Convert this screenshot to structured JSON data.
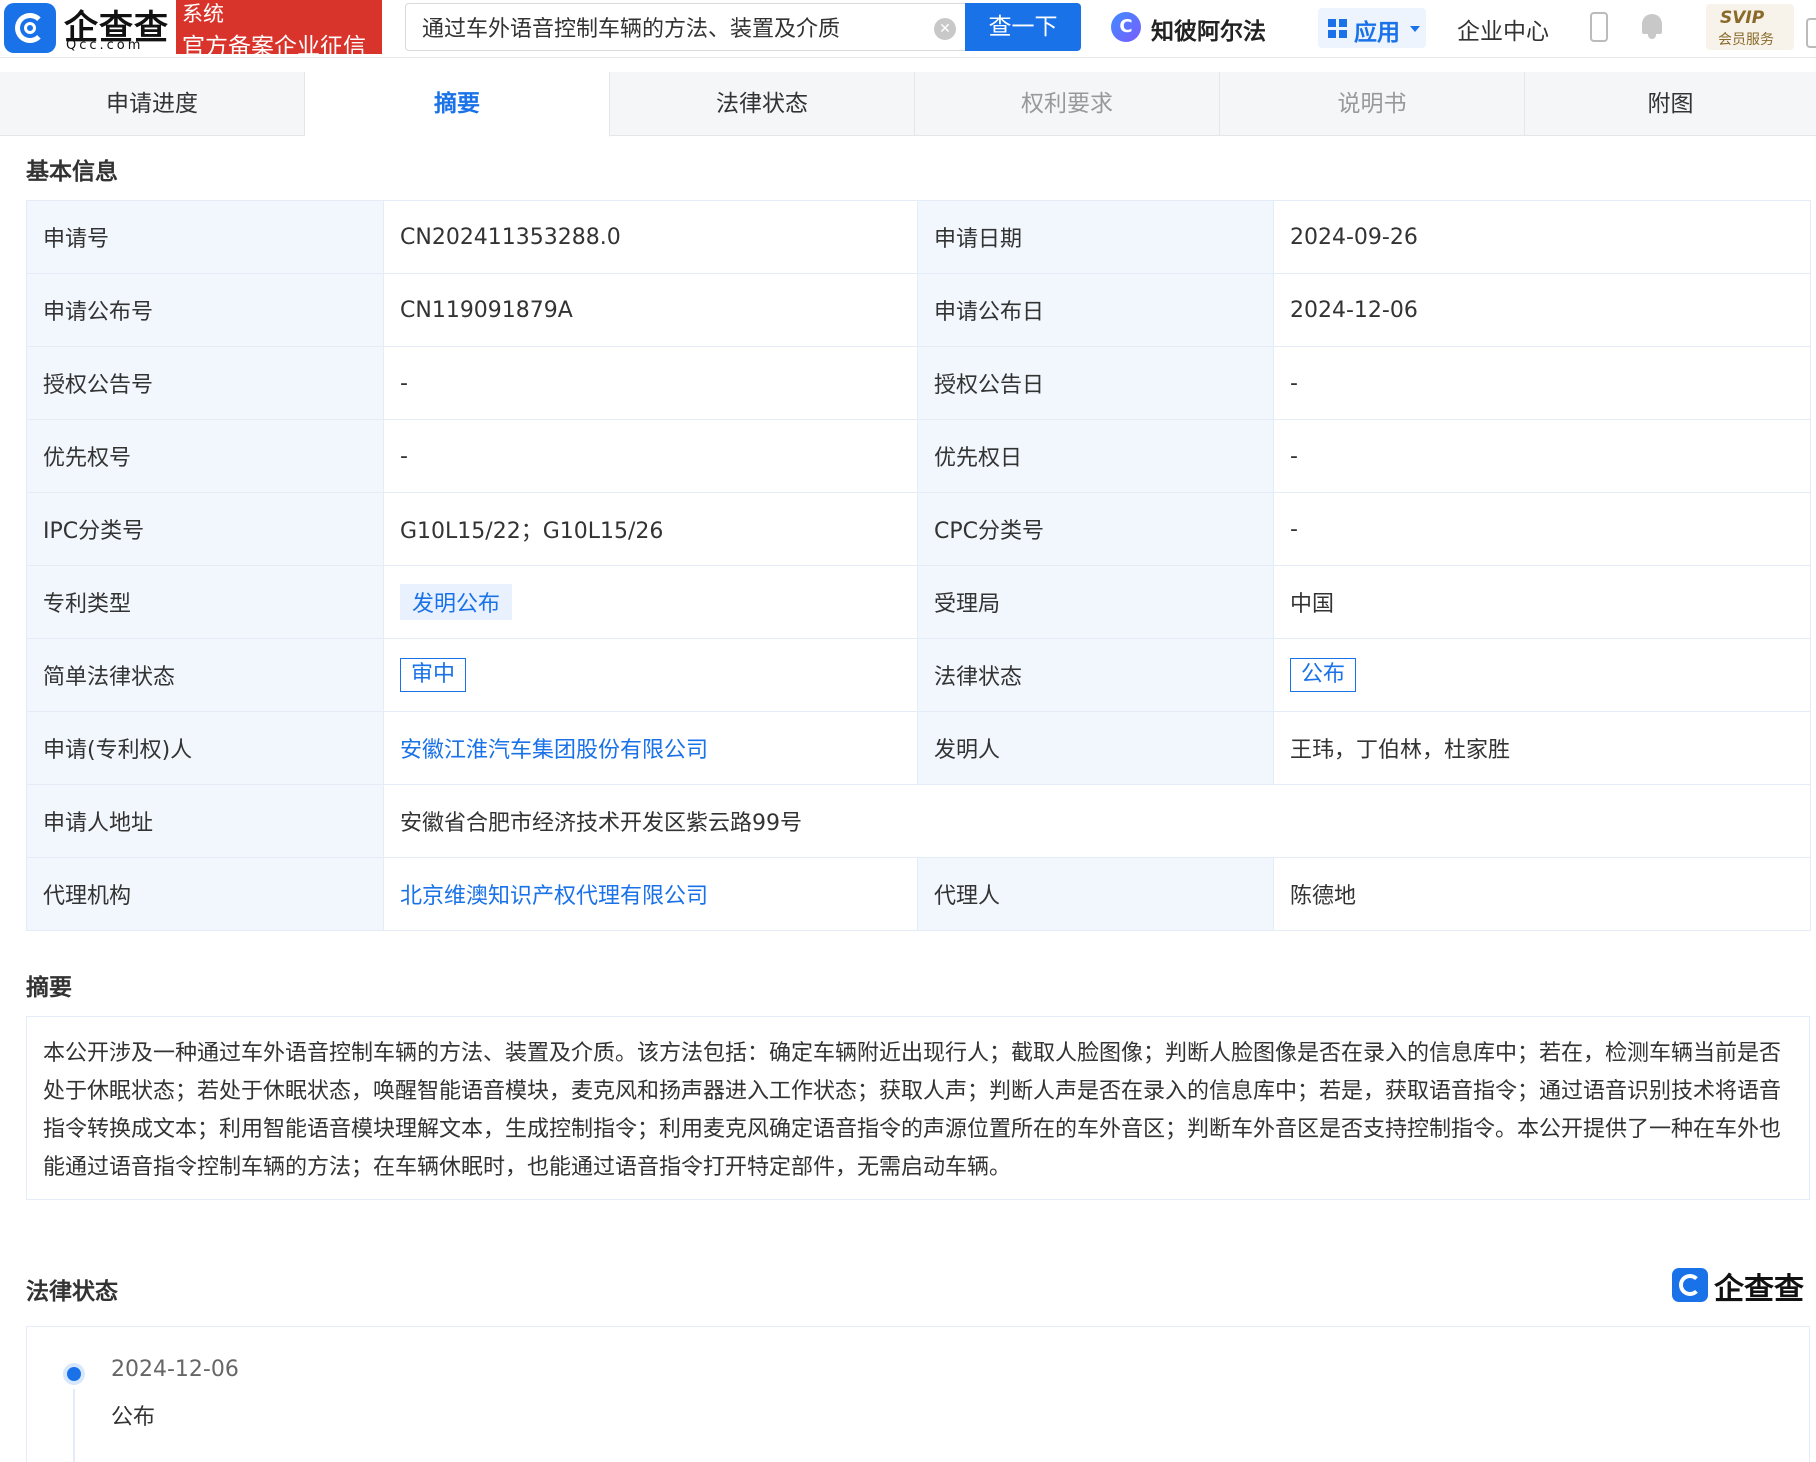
{
  "header": {
    "logo_cn": "企查查",
    "logo_en": "Qcc.com",
    "banner_line1": "系统",
    "banner_line2": "官方备案企业征信",
    "search_value": "通过车外语音控制车辆的方法、装置及介质",
    "search_button": "查一下",
    "zhibi_label": "知彼阿尔法",
    "zhibi_icon_letter": "C",
    "apps_label": "应用",
    "enterprise_center": "企业中心",
    "svip_label": "SVIP",
    "svip_sub": "会员服务"
  },
  "tabs": [
    {
      "label": "申请进度",
      "state": "normal"
    },
    {
      "label": "摘要",
      "state": "active"
    },
    {
      "label": "法律状态",
      "state": "normal"
    },
    {
      "label": "权利要求",
      "state": "dim"
    },
    {
      "label": "说明书",
      "state": "dim"
    },
    {
      "label": "附图",
      "state": "normal"
    }
  ],
  "basic_info": {
    "title": "基本信息",
    "rows": [
      {
        "k1": "申请号",
        "v1": "CN202411353288.0",
        "k2": "申请日期",
        "v2": "2024-09-26"
      },
      {
        "k1": "申请公布号",
        "v1": "CN119091879A",
        "k2": "申请公布日",
        "v2": "2024-12-06"
      },
      {
        "k1": "授权公告号",
        "v1": "-",
        "k2": "授权公告日",
        "v2": "-"
      },
      {
        "k1": "优先权号",
        "v1": "-",
        "k2": "优先权日",
        "v2": "-"
      },
      {
        "k1": "IPC分类号",
        "v1": "G10L15/22；G10L15/26",
        "k2": "CPC分类号",
        "v2": "-"
      },
      {
        "k1": "专利类型",
        "v1": "发明公布",
        "k2": "受理局",
        "v2": "中国"
      },
      {
        "k1": "简单法律状态",
        "v1": "审中",
        "k2": "法律状态",
        "v2": "公布"
      },
      {
        "k1": "申请(专利权)人",
        "v1": "安徽江淮汽车集团股份有限公司",
        "k2": "发明人",
        "v2": "王玮，丁伯林，杜家胜"
      },
      {
        "k1": "申请人地址",
        "v1": "安徽省合肥市经济技术开发区紫云路99号"
      },
      {
        "k1": "代理机构",
        "v1": "北京维澳知识产权代理有限公司",
        "k2": "代理人",
        "v2": "陈德地"
      }
    ]
  },
  "abstract": {
    "title": "摘要",
    "text": "本公开涉及一种通过车外语音控制车辆的方法、装置及介质。该方法包括：确定车辆附近出现行人；截取人脸图像；判断人脸图像是否在录入的信息库中；若在，检测车辆当前是否处于休眠状态；若处于休眠状态，唤醒智能语音模块，麦克风和扬声器进入工作状态；获取人声；判断人声是否在录入的信息库中；若是，获取语音指令；通过语音识别技术将语音指令转换成文本；利用智能语音模块理解文本，生成控制指令；利用麦克风确定语音指令的声源位置所在的车外音区；判断车外音区是否支持控制指令。本公开提供了一种在车外也能通过语音指令控制车辆的方法；在车辆休眠时，也能通过语音指令打开特定部件，无需启动车辆。"
  },
  "legal_status": {
    "title": "法律状态",
    "brand": "企查查",
    "events": [
      {
        "date": "2024-12-06",
        "status": "公布"
      }
    ]
  },
  "colors": {
    "accent": "#1a72e8",
    "banner_red": "#d9342b",
    "key_cell_bg": "#f2f7fd"
  }
}
